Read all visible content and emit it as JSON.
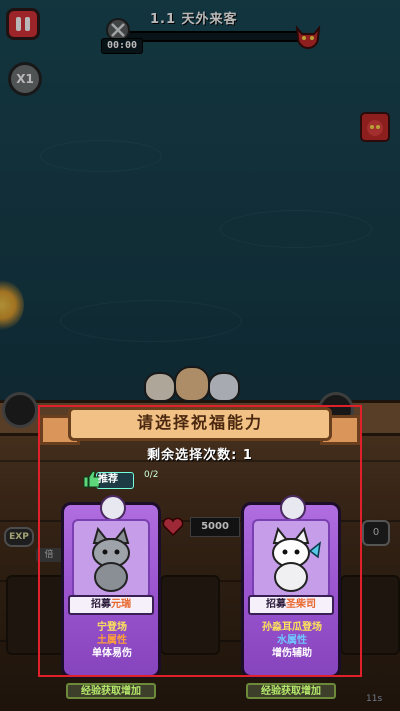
{
  "hud": {
    "level_title": "1.1 天外来客",
    "timer": "00:00",
    "speed_label": "X1"
  },
  "bottom_bar": {
    "exp_label": "EXP",
    "left_chip": "倍",
    "hp_value": "5000",
    "right_label": "0",
    "corner_label": "11s"
  },
  "dialog": {
    "title": "请选择祝福能力",
    "remaining": "剩余选择次数: 1",
    "recommend_label": "推荐",
    "recommend_count": "0/2",
    "cards": [
      {
        "recruit_prefix": "招募",
        "recruit_name": "元瑞",
        "line1": "宁登场",
        "line2": "土属性",
        "line3": "单体易伤",
        "hint": "经验获取增加"
      },
      {
        "recruit_prefix": "招募",
        "recruit_name": "圣柴司",
        "line1": "孙淼耳瓜登场",
        "line2": "水属性",
        "line3": "增伤辅助",
        "hint": "经验获取增加"
      }
    ]
  },
  "colors": {
    "pause_red": "#d8343a",
    "card_purple": "#9a55cf",
    "banner_tan": "#f2c185",
    "highlight_red": "#e0202a"
  }
}
